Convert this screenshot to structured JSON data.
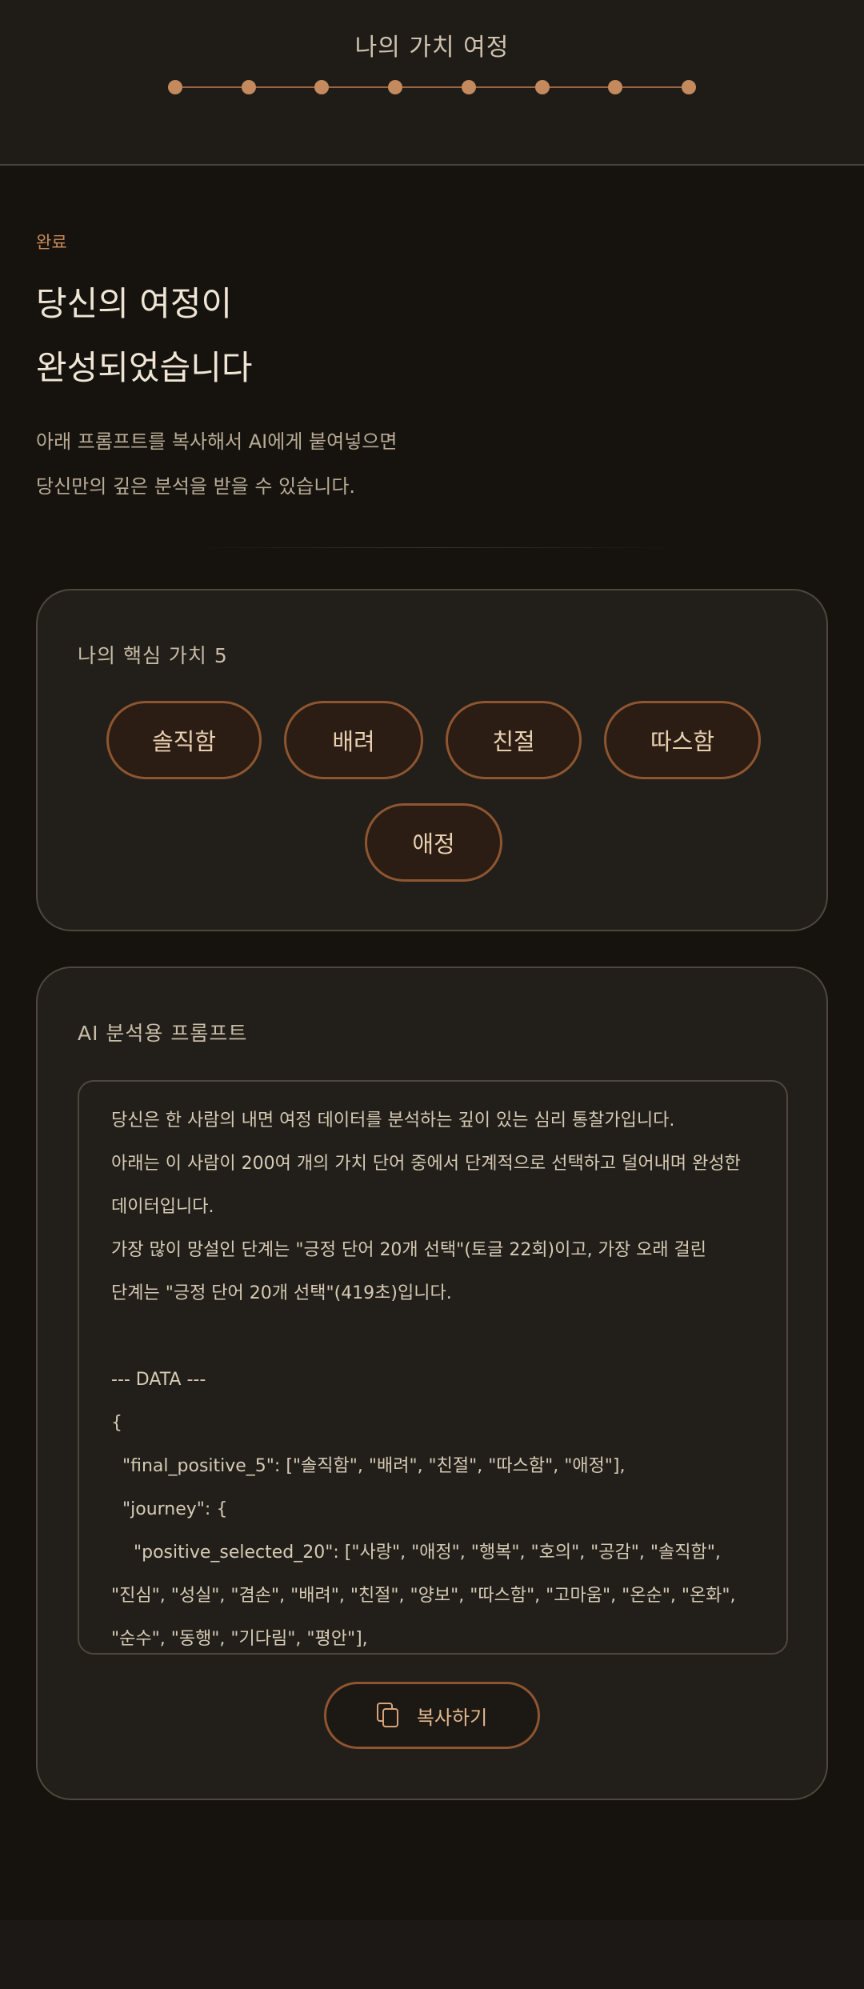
{
  "header": {
    "title": "나의 가치 여정",
    "progress_total_steps": 8,
    "progress_completed_steps": 8
  },
  "intro": {
    "eyebrow": "완료",
    "headline_line1": "당신의 여정이",
    "headline_line2": "완성되었습니다",
    "lead_line1": "아래 프롬프트를 복사해서 AI에게 붙여넣으면",
    "lead_line2": "당신만의 깊은 분석을 받을 수 있습니다."
  },
  "values_card": {
    "label": "나의 핵심 가치 5",
    "chips": [
      "솔직함",
      "배려",
      "친절",
      "따스함",
      "애정"
    ]
  },
  "prompt_card": {
    "label": "AI 분석용 프롬프트",
    "prompt_text": "당신은 한 사람의 내면 여정 데이터를 분석하는 깊이 있는 심리 통찰가입니다.\n아래는 이 사람이 200여 개의 가치 단어 중에서 단계적으로 선택하고 덜어내며 완성한 데이터입니다.\n가장 많이 망설인 단계는 \"긍정 단어 20개 선택\"(토글 22회)이고, 가장 오래 걸린 단계는 \"긍정 단어 20개 선택\"(419초)입니다.\n\n--- DATA ---\n{\n  \"final_positive_5\": [\"솔직함\", \"배려\", \"친절\", \"따스함\", \"애정\"],\n  \"journey\": {\n    \"positive_selected_20\": [\"사랑\", \"애정\", \"행복\", \"호의\", \"공감\", \"솔직함\", \"진심\", \"성실\", \"겸손\", \"배려\", \"친절\", \"양보\", \"따스함\", \"고마움\", \"온순\", \"온화\", \"순수\", \"동행\", \"기다림\", \"평안\"],",
    "copy_label": "복사하기"
  },
  "colors": {
    "background": "#16130f",
    "card": "#221f1b",
    "accent": "#c98a55",
    "chip_border": "#8e5530"
  },
  "icons": {
    "copy": "copy-icon"
  }
}
